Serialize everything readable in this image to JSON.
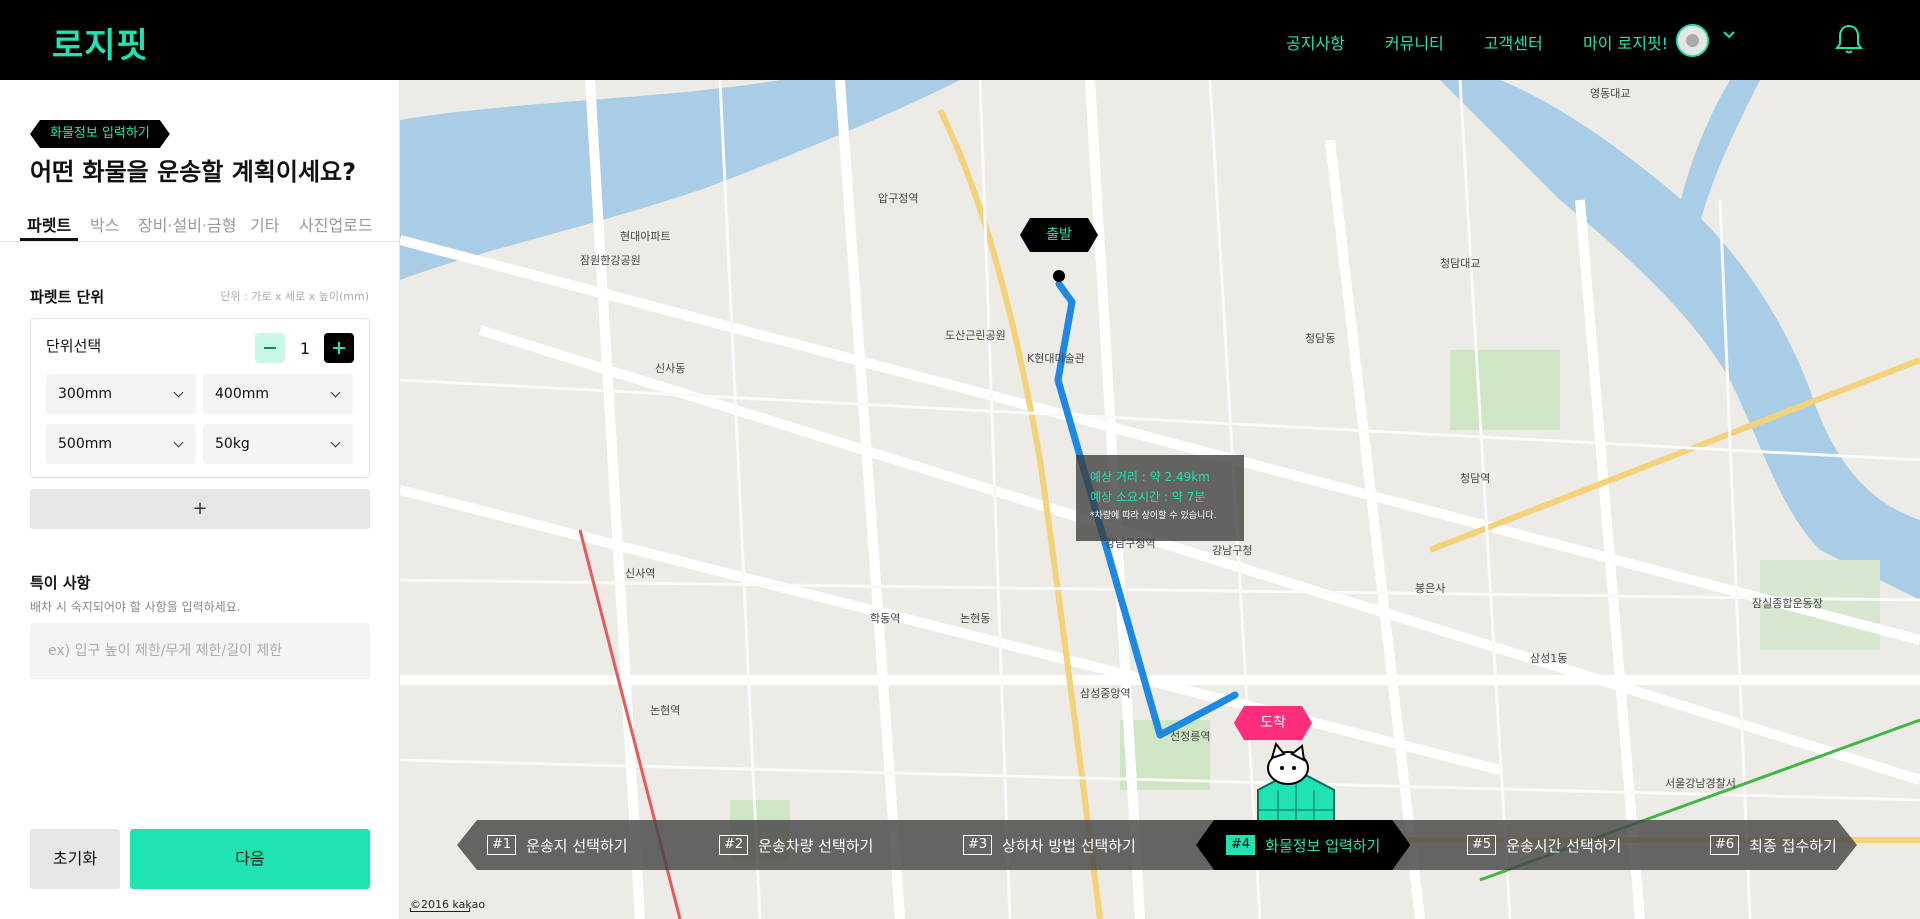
{
  "header": {
    "logo": "로지핏",
    "nav": [
      "공지사항",
      "커뮤니티",
      "고객센터"
    ],
    "my_menu": "마이 로지핏!"
  },
  "panel": {
    "step_badge": "화물정보 입력하기",
    "question": "어떤 화물을 운송할 계획이세요?",
    "tabs": [
      "파렛트",
      "박스",
      "장비·설비·금형",
      "기타",
      "사진업로드"
    ],
    "active_tab": "파렛트",
    "pallet_unit_title": "파렛트 단위",
    "unit_hint": "단위 : 가로 x 세로 x 높이(mm)",
    "unit_select_label": "단위선택",
    "quantity": "1",
    "selects": [
      "300mm",
      "400mm",
      "500mm",
      "50kg"
    ],
    "add_label": "+",
    "notes_title": "특이 사항",
    "notes_hint": "배차 시 숙지되어야 할 사항을 입력하세요.",
    "notes_placeholder": "ex) 입구 높이 제한/무게 제한/길이 제한",
    "reset_label": "초기화",
    "next_label": "다음"
  },
  "map": {
    "start_label": "출발",
    "end_label": "도착",
    "distance": "예상 거리 : 약 2.49km",
    "duration": "예상 소요시간 : 약 7분",
    "note": "*차량에 따라 상이할 수 있습니다.",
    "credit": "©2016 kakao",
    "labels": [
      "압구정역",
      "신사역",
      "논현역",
      "강남구청",
      "강남구청역",
      "삼성중앙역",
      "선정릉역",
      "학동역",
      "청담역",
      "봉은사",
      "삼성1동",
      "청담동",
      "신사동",
      "논현동",
      "잠원한강공원",
      "청담대교",
      "영동대교",
      "서울강남경찰서",
      "잠실종합운동장",
      "현대아파트",
      "도산근린공원",
      "K현대미술관"
    ],
    "route_color": "#1e88e5",
    "accent": "#20e3b2",
    "end_color": "#ff2d7a"
  },
  "steps": [
    {
      "num": "#1",
      "label": "운송지 선택하기"
    },
    {
      "num": "#2",
      "label": "운송차량 선택하기"
    },
    {
      "num": "#3",
      "label": "상하차 방법 선택하기"
    },
    {
      "num": "#4",
      "label": "화물정보 입력하기"
    },
    {
      "num": "#5",
      "label": "운송시간 선택하기"
    },
    {
      "num": "#6",
      "label": "최종 접수하기"
    }
  ],
  "active_step": "#4"
}
